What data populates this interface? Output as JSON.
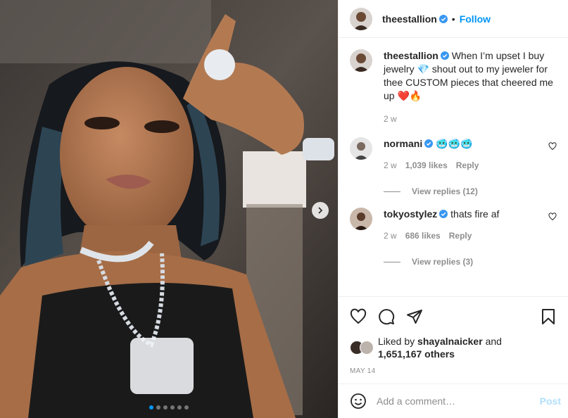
{
  "header": {
    "username": "theestallion",
    "separator": "•",
    "follow_label": "Follow"
  },
  "caption": {
    "username": "theestallion",
    "text_part1": "When I’m upset I buy jewelry",
    "emoji_gem": "💎",
    "text_part2": "shout out to my jeweler for thee CUSTOM pieces that cheered me up",
    "emoji_end": "❤️🔥",
    "age": "2 w"
  },
  "comments": [
    {
      "username": "normani",
      "text": "🥶🥶🥶",
      "age": "2 w",
      "likes": "1,039 likes",
      "reply_label": "Reply",
      "view_replies": "View replies (12)"
    },
    {
      "username": "tokyostylez",
      "text": "thats fire af",
      "age": "2 w",
      "likes": "686 likes",
      "reply_label": "Reply",
      "view_replies": "View replies (3)"
    }
  ],
  "likes": {
    "prefix": "Liked by",
    "user": "shayalnaicker",
    "conj": "and",
    "others": "1,651,167 others"
  },
  "date": "MAY 14",
  "add_comment": {
    "placeholder": "Add a comment…",
    "post_label": "Post"
  },
  "carousel": {
    "slide_count": 6,
    "active_index": 0
  },
  "colors": {
    "accent": "#0095f6",
    "muted": "#8e8e8e",
    "text": "#262626",
    "heart": "#ed4956"
  }
}
